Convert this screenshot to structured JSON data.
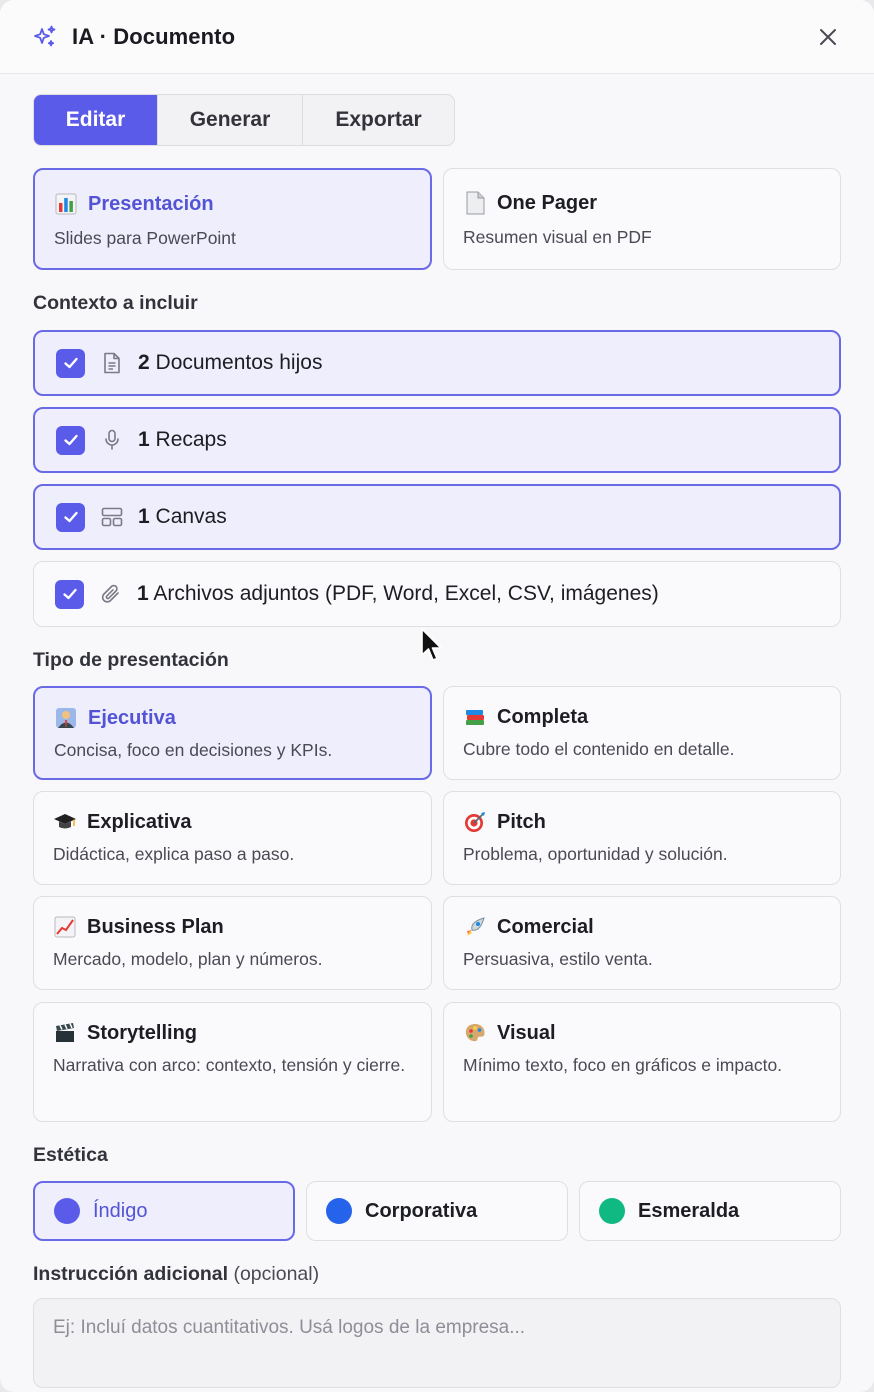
{
  "header": {
    "title": "IA · Documento"
  },
  "tabs": [
    {
      "label": "Editar",
      "active": true
    },
    {
      "label": "Generar",
      "active": false
    },
    {
      "label": "Exportar",
      "active": false
    }
  ],
  "formats": [
    {
      "icon": "bar-chart-icon",
      "title": "Presentación",
      "desc": "Slides para PowerPoint",
      "selected": true
    },
    {
      "icon": "page-icon",
      "title": "One Pager",
      "desc": "Resumen visual en PDF",
      "selected": false
    }
  ],
  "context": {
    "heading": "Contexto a incluir",
    "items": [
      {
        "icon": "document-icon",
        "count": "2",
        "label": "Documentos hijos",
        "checked": true,
        "highlight": true
      },
      {
        "icon": "microphone-icon",
        "count": "1",
        "label": "Recaps",
        "checked": true,
        "highlight": true
      },
      {
        "icon": "layout-icon",
        "count": "1",
        "label": "Canvas",
        "checked": true,
        "highlight": true
      },
      {
        "icon": "paperclip-icon",
        "count": "1",
        "label": "Archivos adjuntos (PDF, Word, Excel, CSV, imágenes)",
        "checked": true,
        "highlight": false
      }
    ]
  },
  "types": {
    "heading": "Tipo de presentación",
    "items": [
      {
        "icon": "businessman-icon",
        "title": "Ejecutiva",
        "desc": "Concisa, foco en decisiones y KPIs.",
        "selected": true
      },
      {
        "icon": "books-icon",
        "title": "Completa",
        "desc": "Cubre todo el contenido en detalle.",
        "selected": false
      },
      {
        "icon": "graduation-cap-icon",
        "title": "Explicativa",
        "desc": "Didáctica, explica paso a paso.",
        "selected": false
      },
      {
        "icon": "target-icon",
        "title": "Pitch",
        "desc": "Problema, oportunidad y solución.",
        "selected": false
      },
      {
        "icon": "trend-chart-icon",
        "title": "Business Plan",
        "desc": "Mercado, modelo, plan y números.",
        "selected": false
      },
      {
        "icon": "rocket-icon",
        "title": "Comercial",
        "desc": "Persuasiva, estilo venta.",
        "selected": false
      },
      {
        "icon": "clapper-icon",
        "title": "Storytelling",
        "desc": "Narrativa con arco: contexto, tensión y cierre.",
        "selected": false
      },
      {
        "icon": "palette-icon",
        "title": "Visual",
        "desc": "Mínimo texto, foco en gráficos e impacto.",
        "selected": false
      }
    ]
  },
  "aesthetics": {
    "heading": "Estética",
    "items": [
      {
        "label": "Índigo",
        "color": "#5b5bea",
        "selected": true
      },
      {
        "label": "Corporativa",
        "color": "#2563eb",
        "selected": false
      },
      {
        "label": "Esmeralda",
        "color": "#10b981",
        "selected": false
      }
    ]
  },
  "instruction": {
    "heading": "Instrucción adicional",
    "optional": "(opcional)",
    "placeholder": "Ej: Incluí datos cuantitativos. Usá logos de la empresa..."
  }
}
